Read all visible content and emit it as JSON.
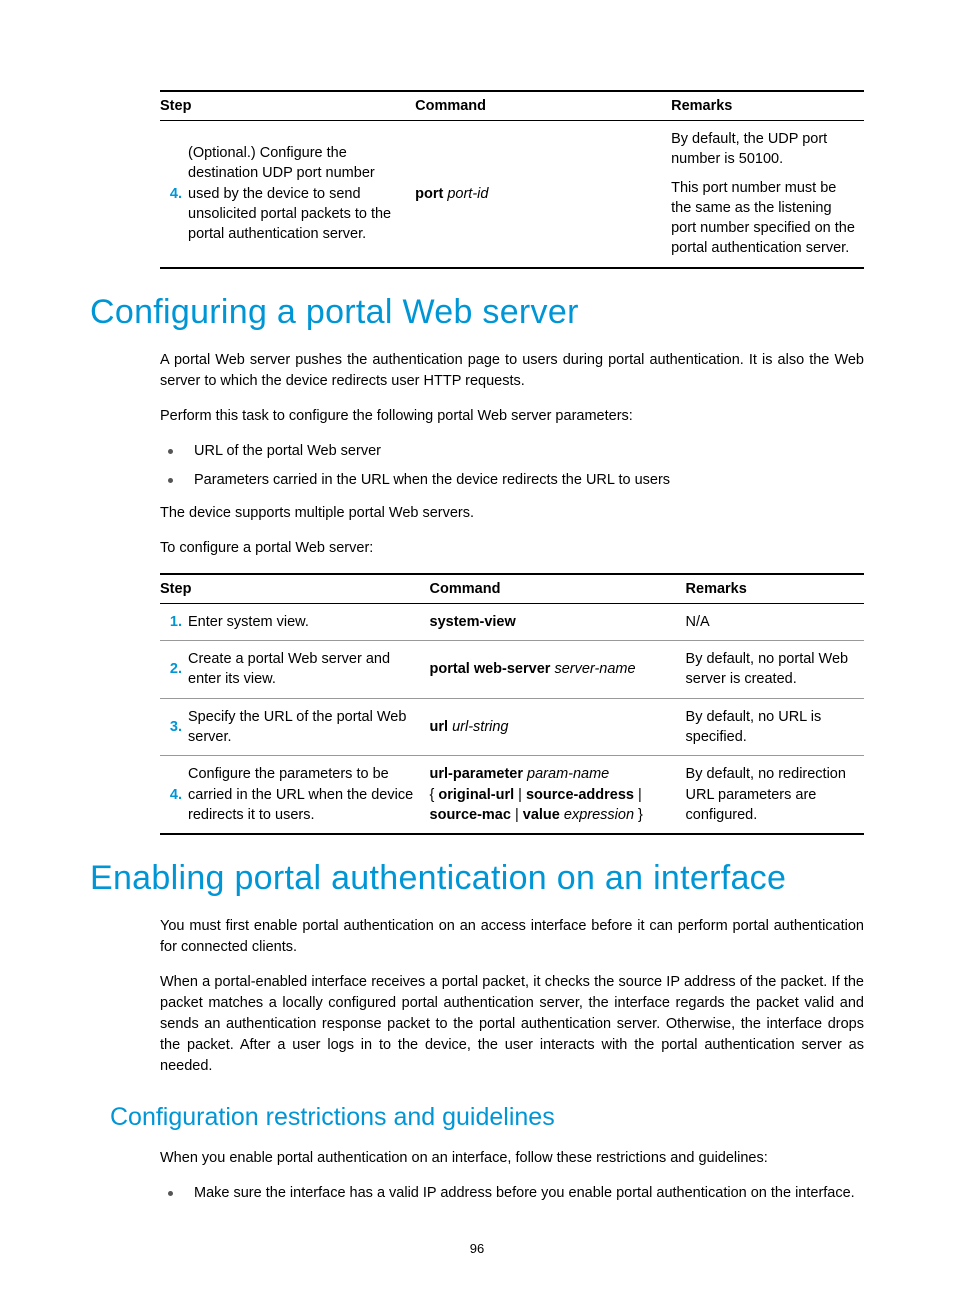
{
  "table1": {
    "headers": {
      "step": "Step",
      "command": "Command",
      "remarks": "Remarks"
    },
    "rows": [
      {
        "num": "4.",
        "step": "(Optional.) Configure the destination UDP port number used by the device to send unsolicited portal packets to the portal authentication server.",
        "cmd_bold": "port",
        "cmd_ital": "port-id",
        "rem1": "By default, the UDP port number is 50100.",
        "rem2": "This port number must be the same as the listening port number specified on the portal authentication server."
      }
    ]
  },
  "section1": {
    "heading": "Configuring a portal Web server",
    "p1": "A portal Web server pushes the authentication page to users during portal authentication. It is also the Web server to which the device redirects user HTTP requests.",
    "p2": "Perform this task to configure the following portal Web server parameters:",
    "bullets": [
      "URL of the portal Web server",
      "Parameters carried in the URL when the device redirects the URL to users"
    ],
    "p3": "The device supports multiple portal Web servers.",
    "p4": "To configure a portal Web server:"
  },
  "table2": {
    "headers": {
      "step": "Step",
      "command": "Command",
      "remarks": "Remarks"
    },
    "rows": [
      {
        "num": "1.",
        "step": "Enter system view.",
        "cmd_bold": "system-view",
        "cmd_ital": "",
        "remarks": "N/A"
      },
      {
        "num": "2.",
        "step": "Create a portal Web server and enter its view.",
        "cmd_bold": "portal web-server",
        "cmd_ital": "server-name",
        "remarks": "By default, no portal Web server is created."
      },
      {
        "num": "3.",
        "step": "Specify the URL of the portal Web server.",
        "cmd_bold": "url",
        "cmd_ital": "url-string",
        "remarks": "By default, no URL is specified."
      },
      {
        "num": "4.",
        "step": "Configure the parameters to be carried in the URL when the device redirects it to users.",
        "cmd_parts": {
          "p1": "url-parameter",
          "p1i": "param-name",
          "brace_open": "{ ",
          "o1": "original-url",
          "sep": " | ",
          "o2": "source-address",
          "o3": "source-mac",
          "o4": "value",
          "o4i": "expression",
          "brace_close": " }"
        },
        "remarks": "By default, no redirection URL parameters are configured."
      }
    ]
  },
  "section2": {
    "heading": "Enabling portal authentication on an interface",
    "p1": "You must first enable portal authentication on an access interface before it can perform portal authentication for connected clients.",
    "p2": "When a portal-enabled interface receives a portal packet, it checks the source IP address of the packet. If the packet matches a locally configured portal authentication server, the interface regards the packet valid and sends an authentication response packet to the portal authentication server. Otherwise, the interface drops the packet. After a user logs in to the device, the user interacts with the portal authentication server as needed."
  },
  "section3": {
    "heading": "Configuration restrictions and guidelines",
    "p1": "When you enable portal authentication on an interface, follow these restrictions and guidelines:",
    "bullets": [
      "Make sure the interface has a valid IP address before you enable portal authentication on the interface."
    ]
  },
  "page_number": "96"
}
